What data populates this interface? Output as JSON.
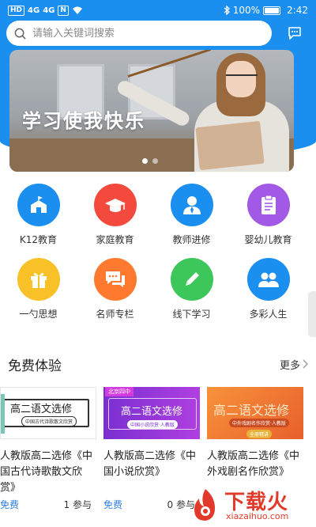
{
  "status_bar": {
    "left_icons": [
      "HD",
      "4G",
      "4G",
      "N",
      "wifi"
    ],
    "battery": "100%",
    "time": "2:42"
  },
  "search": {
    "placeholder": "请输入关键词搜索",
    "message_icon": "message-icon"
  },
  "banner": {
    "slogan": "学习使我快乐",
    "active_index": 0,
    "total": 2
  },
  "categories": [
    {
      "label": "K12教育",
      "color": "#1a8ff0",
      "icon": "school-icon"
    },
    {
      "label": "家庭教育",
      "color": "#f44a3d",
      "icon": "graduation-cap-icon"
    },
    {
      "label": "教师进修",
      "color": "#1a8ff0",
      "icon": "teacher-icon"
    },
    {
      "label": "婴幼儿教育",
      "color": "#a259e6",
      "icon": "clipboard-icon"
    },
    {
      "label": "一勺思想",
      "color": "#f7c127",
      "icon": "gift-icon"
    },
    {
      "label": "名师专栏",
      "color": "#ff7a2f",
      "icon": "chat-icon"
    },
    {
      "label": "线下学习",
      "color": "#3dc65a",
      "icon": "pencil-icon"
    },
    {
      "label": "多彩人生",
      "color": "#1a8ff0",
      "icon": "people-icon"
    }
  ],
  "section": {
    "title": "免费体验",
    "more": "更多"
  },
  "courses": [
    {
      "thumb_title": "高二语文选修",
      "thumb_sub": "中国古代诗歌散文欣赏",
      "title": "人教版高二选修《中国古代诗歌散文欣赏》",
      "price": "免费",
      "participants": "1 参与"
    },
    {
      "thumb_title": "高二语文选修",
      "thumb_sub": "中国小说欣赏·人教版",
      "thumb_tag": "北京四中",
      "title": "人教版高二选修《中国小说欣赏》",
      "price": "免费",
      "participants": "0 参与"
    },
    {
      "thumb_title": "高二语文选修",
      "thumb_sub": "中外戏剧名作欣赏·人教版",
      "thumb_tag": "全册精讲",
      "title": "人教版高二选修《中外戏剧名作欣赏》",
      "price": "",
      "participants": ""
    }
  ],
  "watermark": {
    "brand": "下载火",
    "url": "xiazaihuo.com"
  },
  "colors": {
    "header_blue": "#1a8ff0",
    "price_blue": "#2f7fe0",
    "watermark_red": "#e23a2a"
  }
}
